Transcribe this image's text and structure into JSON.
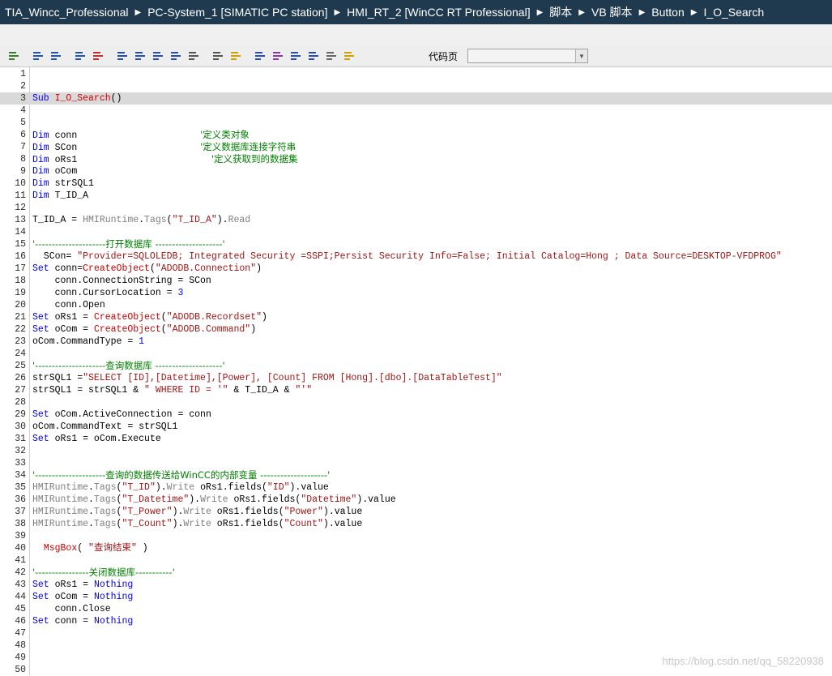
{
  "breadcrumb": [
    "TIA_Wincc_Professional",
    "PC-System_1 [SIMATIC PC station]",
    "HMI_RT_2 [WinCC RT Professional]",
    "脚本",
    "VB 脚本",
    "Button",
    "I_O_Search"
  ],
  "toolbar": {
    "buttons": [
      "syntax-check-icon",
      "indent-icon",
      "outdent-icon",
      "comment-icon",
      "uncomment-icon",
      "bookmark-icon",
      "prev-bookmark-icon",
      "next-bookmark-icon",
      "clear-bookmarks-icon",
      "goto-icon",
      "find-icon",
      "replace-icon",
      "list-members-icon",
      "param-info-icon",
      "quick-info-icon",
      "complete-word-icon",
      "object-list-icon",
      "dynamic-icon"
    ],
    "codepage_label": "代码页",
    "codepage_value": ""
  },
  "editor": {
    "highlighted_line": 3,
    "lines": [
      {
        "n": "1",
        "t": ""
      },
      {
        "n": "2",
        "t": ""
      },
      {
        "n": "3",
        "t": "Sub I_O_Search()"
      },
      {
        "n": "4",
        "t": ""
      },
      {
        "n": "5",
        "t": ""
      },
      {
        "n": "6",
        "t": "Dim conn                      '定义类对象"
      },
      {
        "n": "7",
        "t": "Dim SCon                      '定义数据库连接字符串"
      },
      {
        "n": "8",
        "t": "Dim oRs1                        '定义获取到的数据集"
      },
      {
        "n": "9",
        "t": "Dim oCom"
      },
      {
        "n": "10",
        "t": "Dim strSQL1"
      },
      {
        "n": "11",
        "t": "Dim T_ID_A"
      },
      {
        "n": "12",
        "t": ""
      },
      {
        "n": "13",
        "t": "T_ID_A = HMIRuntime.Tags(\"T_ID_A\").Read"
      },
      {
        "n": "14",
        "t": ""
      },
      {
        "n": "15",
        "t": "'---------------------打开数据库 --------------------'"
      },
      {
        "n": "16",
        "t": "  SCon= \"Provider=SQLOLEDB; Integrated Security =SSPI;Persist Security Info=False; Initial Catalog=Hong ; Data Source=DESKTOP-VFDPROG\""
      },
      {
        "n": "17",
        "t": "Set conn=CreateObject(\"ADODB.Connection\")"
      },
      {
        "n": "18",
        "t": "    conn.ConnectionString = SCon"
      },
      {
        "n": "19",
        "t": "    conn.CursorLocation = 3"
      },
      {
        "n": "20",
        "t": "    conn.Open"
      },
      {
        "n": "21",
        "t": "Set oRs1 = CreateObject(\"ADODB.Recordset\")"
      },
      {
        "n": "22",
        "t": "Set oCom = CreateObject(\"ADODB.Command\")"
      },
      {
        "n": "23",
        "t": "oCom.CommandType = 1"
      },
      {
        "n": "24",
        "t": ""
      },
      {
        "n": "25",
        "t": "'---------------------查询数据库 --------------------'"
      },
      {
        "n": "26",
        "t": "strSQL1 =\"SELECT [ID],[Datetime],[Power], [Count] FROM [Hong].[dbo].[DataTableTest]\""
      },
      {
        "n": "27",
        "t": "strSQL1 = strSQL1 & \" WHERE ID = '\" & T_ID_A & \"'\""
      },
      {
        "n": "28",
        "t": ""
      },
      {
        "n": "29",
        "t": "Set oCom.ActiveConnection = conn"
      },
      {
        "n": "30",
        "t": "oCom.CommandText = strSQL1"
      },
      {
        "n": "31",
        "t": "Set oRs1 = oCom.Execute"
      },
      {
        "n": "32",
        "t": ""
      },
      {
        "n": "33",
        "t": ""
      },
      {
        "n": "34",
        "t": "'---------------------查询的数据传送给WinCC的内部变量 --------------------'"
      },
      {
        "n": "35",
        "t": "HMIRuntime.Tags(\"T_ID\").Write oRs1.fields(\"ID\").value"
      },
      {
        "n": "36",
        "t": "HMIRuntime.Tags(\"T_Datetime\").Write oRs1.fields(\"Datetime\").value"
      },
      {
        "n": "37",
        "t": "HMIRuntime.Tags(\"T_Power\").Write oRs1.fields(\"Power\").value"
      },
      {
        "n": "38",
        "t": "HMIRuntime.Tags(\"T_Count\").Write oRs1.fields(\"Count\").value"
      },
      {
        "n": "39",
        "t": ""
      },
      {
        "n": "40",
        "t": "  MsgBox( \"查询结束\" )"
      },
      {
        "n": "41",
        "t": ""
      },
      {
        "n": "42",
        "t": "'----------------关闭数据库-----------'"
      },
      {
        "n": "43",
        "t": "Set oRs1 = Nothing"
      },
      {
        "n": "44",
        "t": "Set oCom = Nothing"
      },
      {
        "n": "45",
        "t": "    conn.Close"
      },
      {
        "n": "46",
        "t": "Set conn = Nothing"
      },
      {
        "n": "47",
        "t": ""
      },
      {
        "n": "48",
        "t": ""
      },
      {
        "n": "49",
        "t": ""
      },
      {
        "n": "50",
        "t": ""
      }
    ]
  },
  "watermark": "https://blog.csdn.net/qq_58220938",
  "colors": {
    "titlebar": "#1f3a4f",
    "keyword": "#0000ff",
    "string": "#a31515",
    "comment": "#008000",
    "object": "#7f7f7f",
    "proc_name": "#d00000"
  }
}
